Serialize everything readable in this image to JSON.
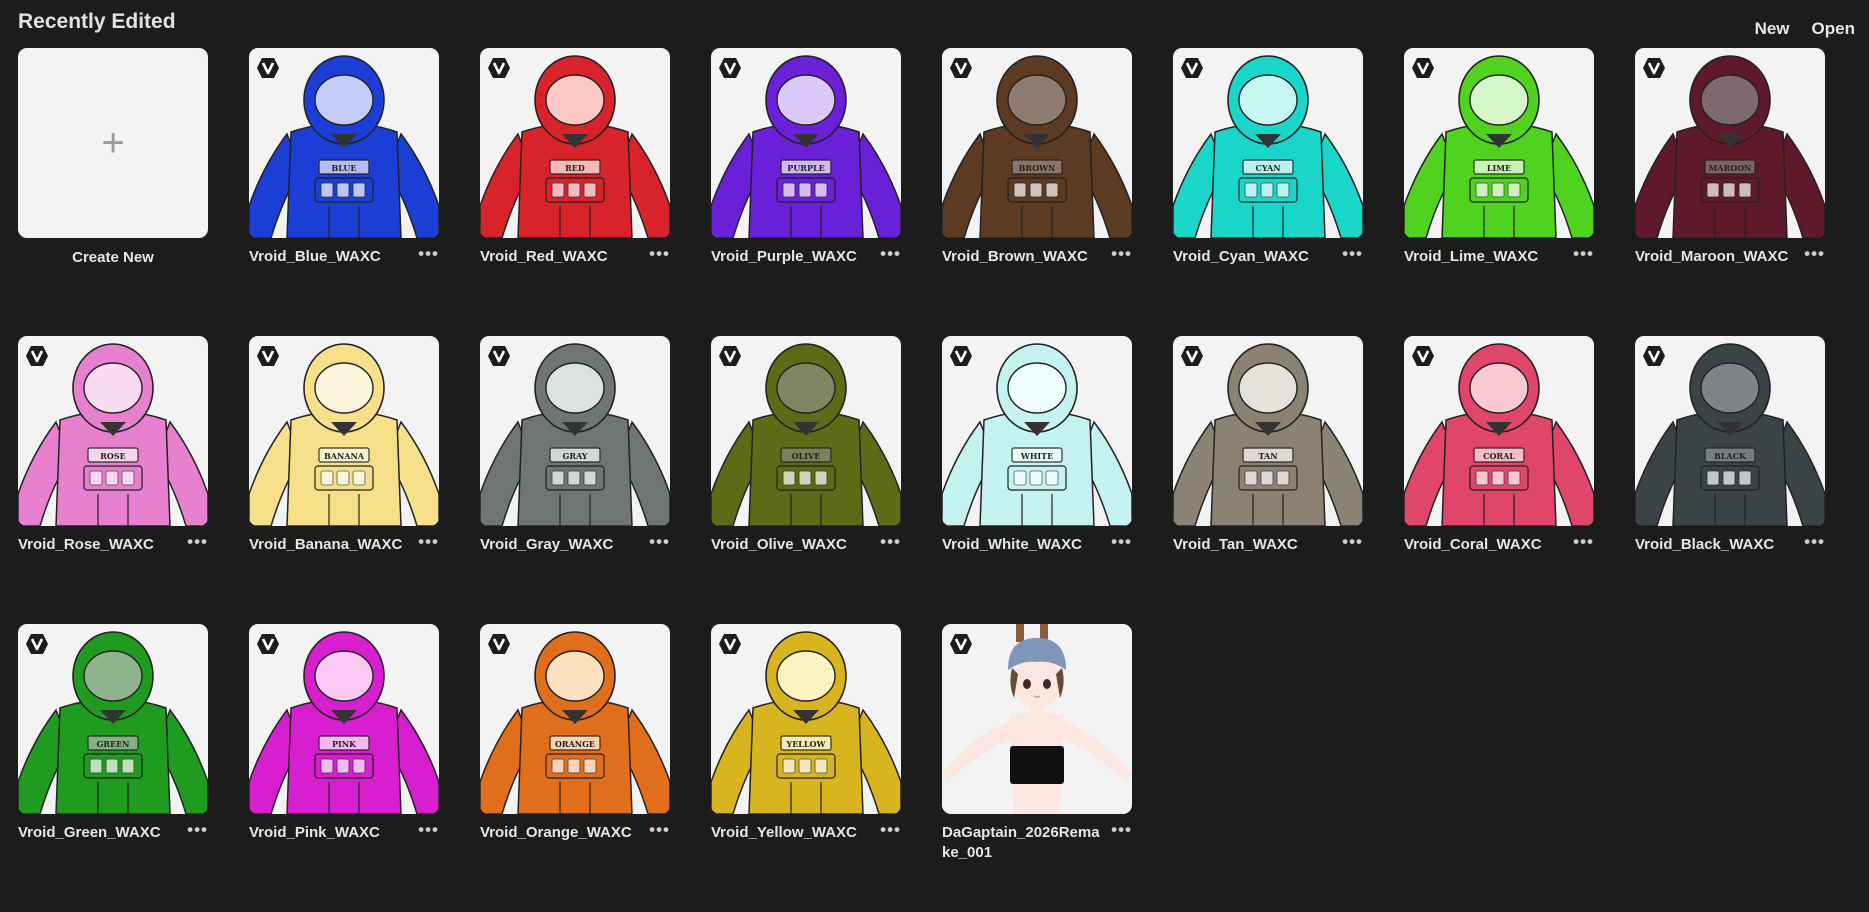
{
  "header": {
    "title": "Recently Edited",
    "new_label": "New",
    "open_label": "Open"
  },
  "create": {
    "plus": "+",
    "label": "Create New"
  },
  "more_glyph": "•••",
  "badge_icon": "vroid-v-icon",
  "models": [
    {
      "name": "Vroid_Blue_WAXC",
      "suit": "#1b3fd6",
      "visor": "#c5cbf7",
      "tag": "BLUE"
    },
    {
      "name": "Vroid_Red_WAXC",
      "suit": "#d8232b",
      "visor": "#fbc8c6",
      "tag": "RED"
    },
    {
      "name": "Vroid_Purple_WAXC",
      "suit": "#6a1fd8",
      "visor": "#dcc8f7",
      "tag": "PURPLE"
    },
    {
      "name": "Vroid_Brown_WAXC",
      "suit": "#5c3b22",
      "visor": "#8e7c70",
      "tag": "BROWN"
    },
    {
      "name": "Vroid_Cyan_WAXC",
      "suit": "#1ad6c8",
      "visor": "#c8f7f1",
      "tag": "CYAN"
    },
    {
      "name": "Vroid_Lime_WAXC",
      "suit": "#4fd31f",
      "visor": "#d6f7c8",
      "tag": "LIME"
    },
    {
      "name": "Vroid_Maroon_WAXC",
      "suit": "#5e1a2c",
      "visor": "#7e6a6e",
      "tag": "MAROON"
    },
    {
      "name": "Vroid_Rose_WAXC",
      "suit": "#e880d0",
      "visor": "#fadcf2",
      "tag": "ROSE"
    },
    {
      "name": "Vroid_Banana_WAXC",
      "suit": "#f7e08a",
      "visor": "#fdf6dc",
      "tag": "BANANA"
    },
    {
      "name": "Vroid_Gray_WAXC",
      "suit": "#6f7574",
      "visor": "#dde1e0",
      "tag": "GRAY"
    },
    {
      "name": "Vroid_Olive_WAXC",
      "suit": "#5e6a16",
      "visor": "#7e8560",
      "tag": "OLIVE"
    },
    {
      "name": "Vroid_White_WAXC",
      "suit": "#c4f3f1",
      "visor": "#eefcfb",
      "tag": "WHITE"
    },
    {
      "name": "Vroid_Tan_WAXC",
      "suit": "#8c8274",
      "visor": "#e6e2dc",
      "tag": "TAN"
    },
    {
      "name": "Vroid_Coral_WAXC",
      "suit": "#e0456a",
      "visor": "#f9c8d2",
      "tag": "CORAL"
    },
    {
      "name": "Vroid_Black_WAXC",
      "suit": "#3a4446",
      "visor": "#7e8486",
      "tag": "BLACK"
    },
    {
      "name": "Vroid_Green_WAXC",
      "suit": "#1f9c1f",
      "visor": "#8eb48e",
      "tag": "GREEN"
    },
    {
      "name": "Vroid_Pink_WAXC",
      "suit": "#d81fd0",
      "visor": "#fbc8f3",
      "tag": "PINK"
    },
    {
      "name": "Vroid_Orange_WAXC",
      "suit": "#e06e1a",
      "visor": "#fde0c0",
      "tag": "ORANGE"
    },
    {
      "name": "Vroid_Yellow_WAXC",
      "suit": "#d8b41f",
      "visor": "#fbf3c0",
      "tag": "YELLOW"
    },
    {
      "name": "DaGaptain_2026Remake_001",
      "type": "girl",
      "hat": "#7e96b8",
      "skin": "#fbe6e0",
      "top": "#111111"
    }
  ]
}
